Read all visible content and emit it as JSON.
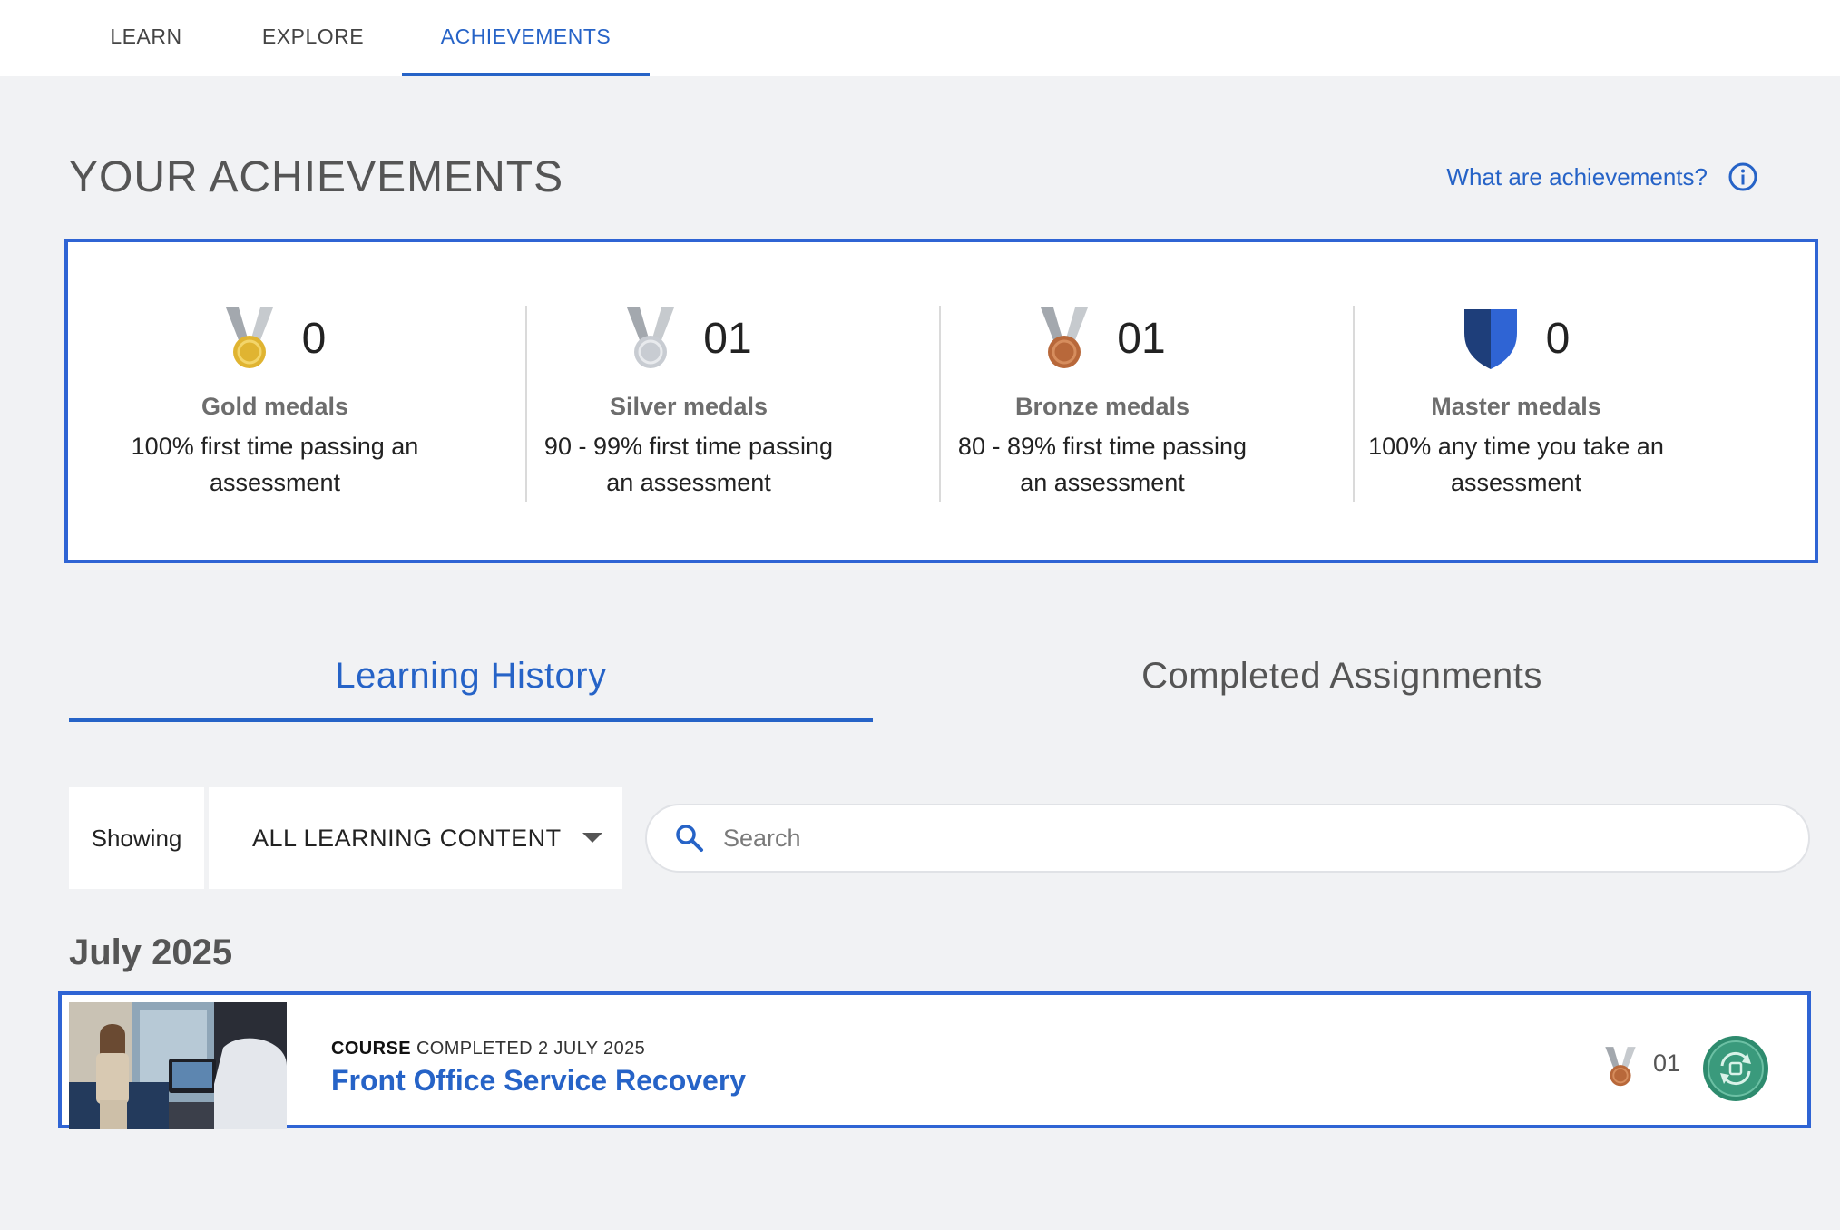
{
  "nav": {
    "tabs": [
      {
        "label": "LEARN"
      },
      {
        "label": "EXPLORE"
      },
      {
        "label": "ACHIEVEMENTS"
      }
    ],
    "active": "ACHIEVEMENTS"
  },
  "page": {
    "title": "YOUR ACHIEVEMENTS",
    "help_link": "What are achievements?",
    "help_icon": "info-icon"
  },
  "medals": [
    {
      "count": "0",
      "name": "Gold medals",
      "desc": "100% first time passing an assessment",
      "icon": "gold-medal-icon",
      "color": "#e0b431"
    },
    {
      "count": "01",
      "name": "Silver medals",
      "desc": "90 - 99% first time passing an assessment",
      "icon": "silver-medal-icon",
      "color": "#c8ccd2"
    },
    {
      "count": "01",
      "name": "Bronze medals",
      "desc": "80 - 89% first time passing an assessment",
      "icon": "bronze-medal-icon",
      "color": "#b8683a"
    },
    {
      "count": "0",
      "name": "Master medals",
      "desc": "100% any time you take an assessment",
      "icon": "master-shield-icon",
      "color": "#2f64d4"
    }
  ],
  "subtabs": [
    {
      "label": "Learning History",
      "active": true
    },
    {
      "label": "Completed Assignments",
      "active": false
    }
  ],
  "filter": {
    "showing_label": "Showing",
    "selected": "ALL LEARNING CONTENT"
  },
  "search": {
    "placeholder": "Search"
  },
  "history": {
    "month": "July 2025",
    "items": [
      {
        "kind": "COURSE",
        "status": "COMPLETED 2 JULY 2025",
        "title": "Front Office Service Recovery",
        "medal": "bronze-medal-icon",
        "medal_count": "01",
        "badge": "refresh-badge-icon"
      }
    ]
  },
  "colors": {
    "accent": "#2663c7",
    "panel_border": "#2f64d4",
    "background": "#f1f2f4",
    "badge_green": "#2e8b6e"
  }
}
